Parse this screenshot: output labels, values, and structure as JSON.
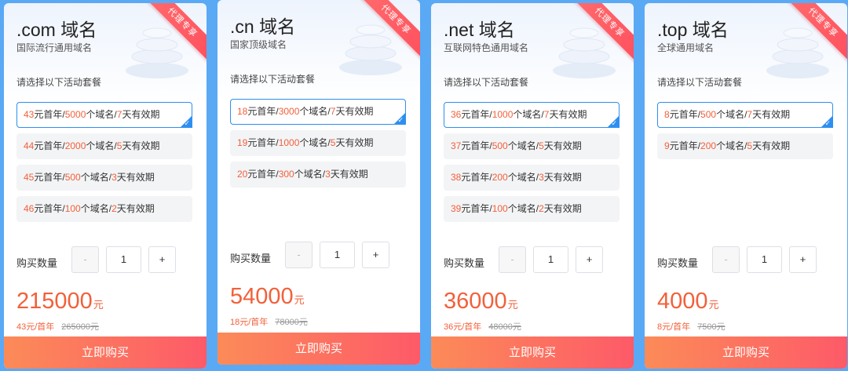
{
  "ribbon_text": "代理专享",
  "hint": "请选择以下活动套餐",
  "qty_label": "购买数量",
  "minus": "-",
  "plus": "+",
  "buy_label": "立即购买",
  "currency": "元",
  "accent_color": "#f2603a",
  "selected_border_color": "#2e8ff0",
  "cards": [
    {
      "title": ".com 域名",
      "subtitle": "国际流行通用域名",
      "options": [
        {
          "price": "43",
          "count": "5000",
          "days": "7"
        },
        {
          "price": "44",
          "count": "2000",
          "days": "5"
        },
        {
          "price": "45",
          "count": "500",
          "days": "3"
        },
        {
          "price": "46",
          "count": "100",
          "days": "2"
        }
      ],
      "selected": 0,
      "quantity": "1",
      "total": "215000",
      "unit_price": "43元/首年",
      "original": "265000元"
    },
    {
      "title": ".cn 域名",
      "subtitle": "国家顶级域名",
      "options": [
        {
          "price": "18",
          "count": "3000",
          "days": "7"
        },
        {
          "price": "19",
          "count": "1000",
          "days": "5"
        },
        {
          "price": "20",
          "count": "300",
          "days": "3"
        }
      ],
      "selected": 0,
      "quantity": "1",
      "total": "54000",
      "unit_price": "18元/首年",
      "original": "78000元"
    },
    {
      "title": ".net 域名",
      "subtitle": "互联网特色通用域名",
      "options": [
        {
          "price": "36",
          "count": "1000",
          "days": "7"
        },
        {
          "price": "37",
          "count": "500",
          "days": "5"
        },
        {
          "price": "38",
          "count": "200",
          "days": "3"
        },
        {
          "price": "39",
          "count": "100",
          "days": "2"
        }
      ],
      "selected": 0,
      "quantity": "1",
      "total": "36000",
      "unit_price": "36元/首年",
      "original": "48000元"
    },
    {
      "title": ".top 域名",
      "subtitle": "全球通用域名",
      "options": [
        {
          "price": "8",
          "count": "500",
          "days": "7"
        },
        {
          "price": "9",
          "count": "200",
          "days": "5"
        }
      ],
      "selected": 0,
      "quantity": "1",
      "total": "4000",
      "unit_price": "8元/首年",
      "original": "7500元"
    }
  ]
}
